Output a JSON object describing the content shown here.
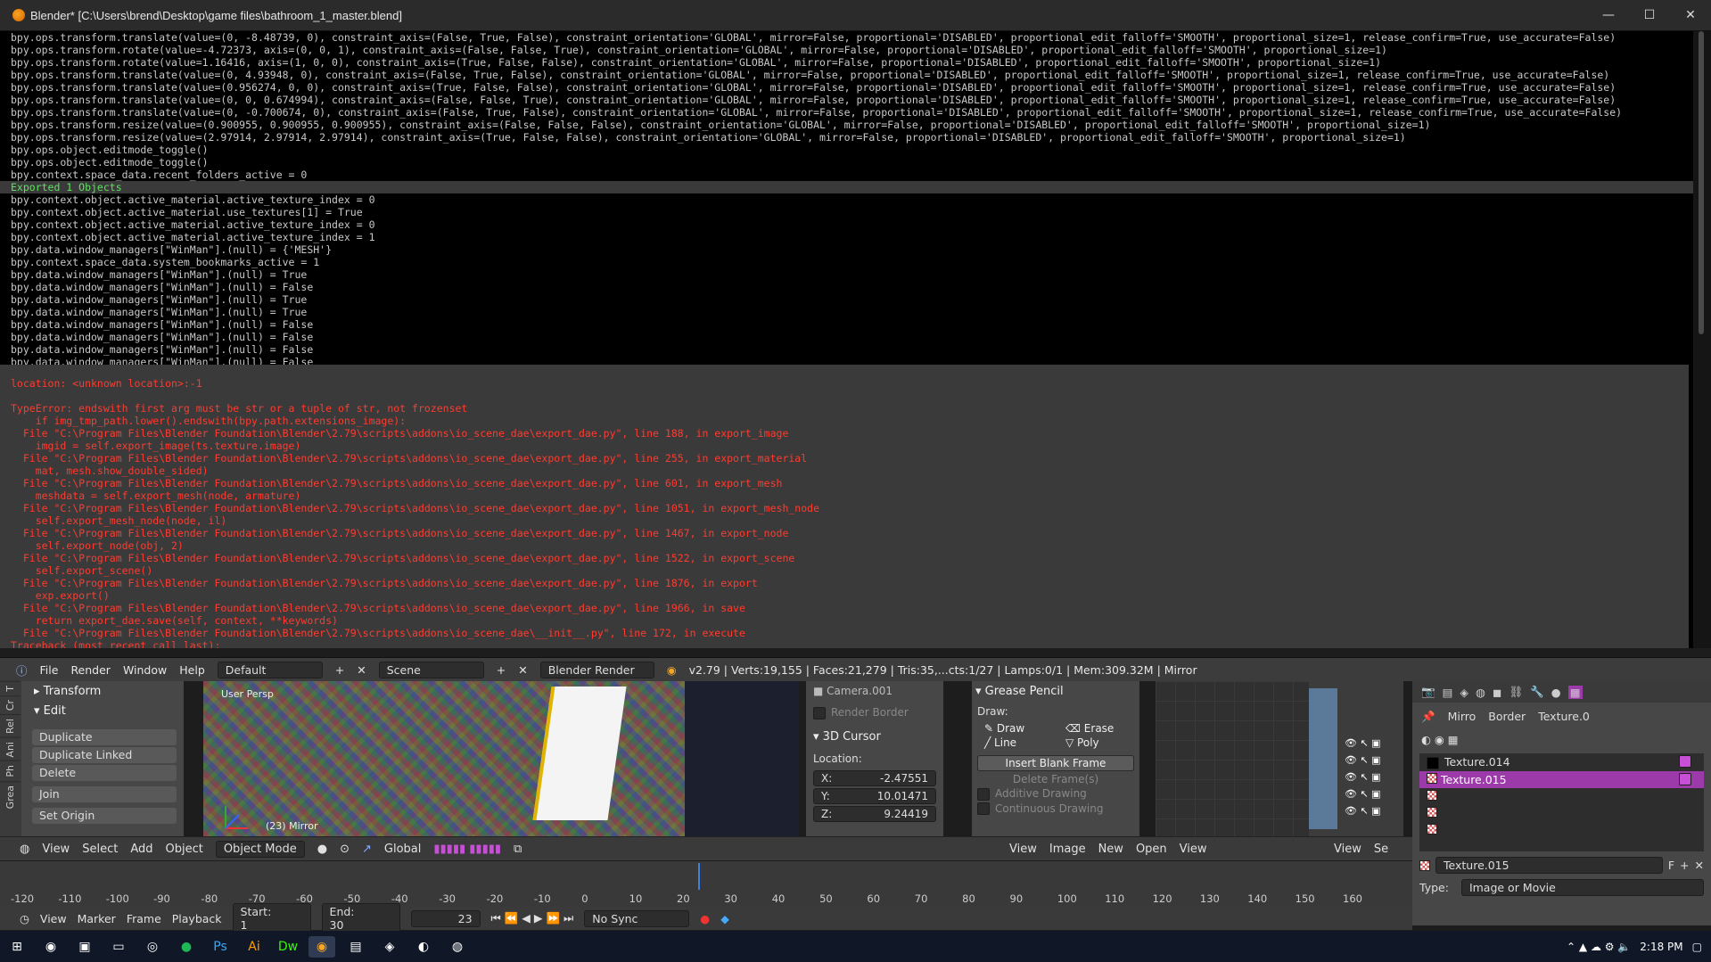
{
  "window": {
    "title": "Blender* [C:\\Users\\brend\\Desktop\\game files\\bathroom_1_master.blend]",
    "minimize": "—",
    "maximize": "☐",
    "close": "✕"
  },
  "console": {
    "log_lines": [
      "bpy.ops.transform.translate(value=(0, -8.48739, 0), constraint_axis=(False, True, False), constraint_orientation='GLOBAL', mirror=False, proportional='DISABLED', proportional_edit_falloff='SMOOTH', proportional_size=1, release_confirm=True, use_accurate=False)",
      "bpy.ops.transform.rotate(value=-4.72373, axis=(0, 0, 1), constraint_axis=(False, False, True), constraint_orientation='GLOBAL', mirror=False, proportional='DISABLED', proportional_edit_falloff='SMOOTH', proportional_size=1)",
      "bpy.ops.transform.rotate(value=1.16416, axis=(1, 0, 0), constraint_axis=(True, False, False), constraint_orientation='GLOBAL', mirror=False, proportional='DISABLED', proportional_edit_falloff='SMOOTH', proportional_size=1)",
      "bpy.ops.transform.translate(value=(0, 4.93948, 0), constraint_axis=(False, True, False), constraint_orientation='GLOBAL', mirror=False, proportional='DISABLED', proportional_edit_falloff='SMOOTH', proportional_size=1, release_confirm=True, use_accurate=False)",
      "bpy.ops.transform.translate(value=(0.956274, 0, 0), constraint_axis=(True, False, False), constraint_orientation='GLOBAL', mirror=False, proportional='DISABLED', proportional_edit_falloff='SMOOTH', proportional_size=1, release_confirm=True, use_accurate=False)",
      "bpy.ops.transform.translate(value=(0, 0, 0.674994), constraint_axis=(False, False, True), constraint_orientation='GLOBAL', mirror=False, proportional='DISABLED', proportional_edit_falloff='SMOOTH', proportional_size=1, release_confirm=True, use_accurate=False)",
      "bpy.ops.transform.translate(value=(0, -0.700674, 0), constraint_axis=(False, True, False), constraint_orientation='GLOBAL', mirror=False, proportional='DISABLED', proportional_edit_falloff='SMOOTH', proportional_size=1, release_confirm=True, use_accurate=False)",
      "bpy.ops.transform.resize(value=(0.900955, 0.900955, 0.900955), constraint_axis=(False, False, False), constraint_orientation='GLOBAL', mirror=False, proportional='DISABLED', proportional_edit_falloff='SMOOTH', proportional_size=1)",
      "bpy.ops.transform.resize(value=(2.97914, 2.97914, 2.97914), constraint_axis=(True, False, False), constraint_orientation='GLOBAL', mirror=False, proportional='DISABLED', proportional_edit_falloff='SMOOTH', proportional_size=1)",
      "bpy.ops.object.editmode_toggle()",
      "bpy.ops.object.editmode_toggle()",
      "bpy.context.space_data.recent_folders_active = 0"
    ],
    "highlight_line": "Exported 1 Objects",
    "log_lines_2": [
      "bpy.context.object.active_material.active_texture_index = 0",
      "bpy.context.object.active_material.use_textures[1] = True",
      "bpy.context.object.active_material.active_texture_index = 0",
      "bpy.context.object.active_material.active_texture_index = 1",
      "bpy.data.window_managers[\"WinMan\"].(null) = {'MESH'}",
      "bpy.context.space_data.system_bookmarks_active = 1",
      "bpy.data.window_managers[\"WinMan\"].(null) = True",
      "bpy.data.window_managers[\"WinMan\"].(null) = False",
      "bpy.data.window_managers[\"WinMan\"].(null) = True",
      "bpy.data.window_managers[\"WinMan\"].(null) = True",
      "bpy.data.window_managers[\"WinMan\"].(null) = False",
      "bpy.data.window_managers[\"WinMan\"].(null) = False",
      "bpy.data.window_managers[\"WinMan\"].(null) = False",
      "bpy.data.window_managers[\"WinMan\"].(null) = False"
    ],
    "error_lines": [
      "",
      "location: <unknown location>:-1",
      "",
      "TypeError: endswith first arg must be str or a tuple of str, not frozenset",
      "    if img_tmp_path.lower().endswith(bpy.path.extensions_image):",
      "  File \"C:\\Program Files\\Blender Foundation\\Blender\\2.79\\scripts\\addons\\io_scene_dae\\export_dae.py\", line 188, in export_image",
      "    imgid = self.export_image(ts.texture.image)",
      "  File \"C:\\Program Files\\Blender Foundation\\Blender\\2.79\\scripts\\addons\\io_scene_dae\\export_dae.py\", line 255, in export_material",
      "    mat, mesh.show_double_sided)",
      "  File \"C:\\Program Files\\Blender Foundation\\Blender\\2.79\\scripts\\addons\\io_scene_dae\\export_dae.py\", line 601, in export_mesh",
      "    meshdata = self.export_mesh(node, armature)",
      "  File \"C:\\Program Files\\Blender Foundation\\Blender\\2.79\\scripts\\addons\\io_scene_dae\\export_dae.py\", line 1051, in export_mesh_node",
      "    self.export_mesh_node(node, il)",
      "  File \"C:\\Program Files\\Blender Foundation\\Blender\\2.79\\scripts\\addons\\io_scene_dae\\export_dae.py\", line 1467, in export_node",
      "    self.export_node(obj, 2)",
      "  File \"C:\\Program Files\\Blender Foundation\\Blender\\2.79\\scripts\\addons\\io_scene_dae\\export_dae.py\", line 1522, in export_scene",
      "    self.export_scene()",
      "  File \"C:\\Program Files\\Blender Foundation\\Blender\\2.79\\scripts\\addons\\io_scene_dae\\export_dae.py\", line 1876, in export",
      "    exp.export()",
      "  File \"C:\\Program Files\\Blender Foundation\\Blender\\2.79\\scripts\\addons\\io_scene_dae\\export_dae.py\", line 1966, in save",
      "    return export_dae.save(self, context, **keywords)",
      "  File \"C:\\Program Files\\Blender Foundation\\Blender\\2.79\\scripts\\addons\\io_scene_dae\\__init__.py\", line 172, in execute",
      "Traceback (most recent call last):"
    ]
  },
  "infobar": {
    "menus": [
      "File",
      "Render",
      "Window",
      "Help"
    ],
    "layout": "Default",
    "scene": "Scene",
    "engine": "Blender Render",
    "stats": "v2.79 | Verts:19,155 | Faces:21,279 | Tris:35,...cts:1/27 | Lamps:0/1 | Mem:309.32M | Mirror"
  },
  "tool_tabs": [
    "Tools",
    "Create",
    "Relations",
    "Animation",
    "Physics",
    "Grease Pencil"
  ],
  "tool_tab_labels": [
    "T",
    "Cr",
    "Rel",
    "Ani",
    "Ph",
    "Grea"
  ],
  "toolshelf": {
    "transform_header": "Transform",
    "edit_header": "Edit",
    "buttons": [
      "Duplicate",
      "Duplicate Linked",
      "Delete"
    ],
    "join": "Join",
    "set_origin": "Set Origin"
  },
  "viewport": {
    "label": "User Persp",
    "object_label": "(23) Mirror"
  },
  "npanel": {
    "camera": "Camera.001",
    "render_border": "Render Border",
    "cursor_header": "3D Cursor",
    "location_label": "Location:",
    "x_label": "X:",
    "x": "-2.47551",
    "y_label": "Y:",
    "y": "10.01471",
    "z_label": "Z:",
    "z": "9.24419"
  },
  "grease_pencil": {
    "header": "Grease Pencil",
    "draw_label": "Draw:",
    "draw": "Draw",
    "erase": "Erase",
    "line": "Line",
    "poly": "Poly",
    "insert_blank": "Insert Blank Frame",
    "delete_frames": "Delete Frame(s)",
    "additive": "Additive Drawing",
    "continuous": "Continuous Drawing"
  },
  "view3d_header": {
    "view": "View",
    "select": "Select",
    "add": "Add",
    "object": "Object",
    "mode": "Object Mode",
    "orientation": "Global"
  },
  "image_header": {
    "view": "View",
    "image": "Image",
    "new": "New",
    "open": "Open",
    "view2": "View"
  },
  "outliner_header": {
    "view": "View",
    "search": "Se"
  },
  "properties": {
    "tabs": [
      "Mirro",
      "Border",
      "Texture.0"
    ],
    "textures": [
      "Texture.014",
      "Texture.015"
    ],
    "selected_texture": "Texture.015",
    "texture_name": "Texture.015",
    "fake_user": "F",
    "type_label": "Type:",
    "type_value": "Image or Movie"
  },
  "timeline": {
    "ticks": [
      "-120",
      "-110",
      "-100",
      "-90",
      "-80",
      "-70",
      "-60",
      "-50",
      "-40",
      "-30",
      "-20",
      "-10",
      "0",
      "10",
      "20",
      "30",
      "40",
      "50",
      "60",
      "70",
      "80",
      "90",
      "100",
      "110",
      "120",
      "130",
      "140",
      "150",
      "160"
    ],
    "current_frame_value": 23,
    "menus": [
      "View",
      "Marker",
      "Frame",
      "Playback"
    ],
    "start_label": "Start:",
    "start": "1",
    "end_label": "End:",
    "end": "30",
    "frame": "23",
    "sync": "No Sync"
  },
  "taskbar": {
    "time": "2:18 PM"
  },
  "colors": {
    "console_bg": "#000000",
    "error_text": "#ff3b2f",
    "success_text": "#5de35d",
    "accent_selected": "#9b3aa8",
    "playhead": "#3d7fe0"
  }
}
